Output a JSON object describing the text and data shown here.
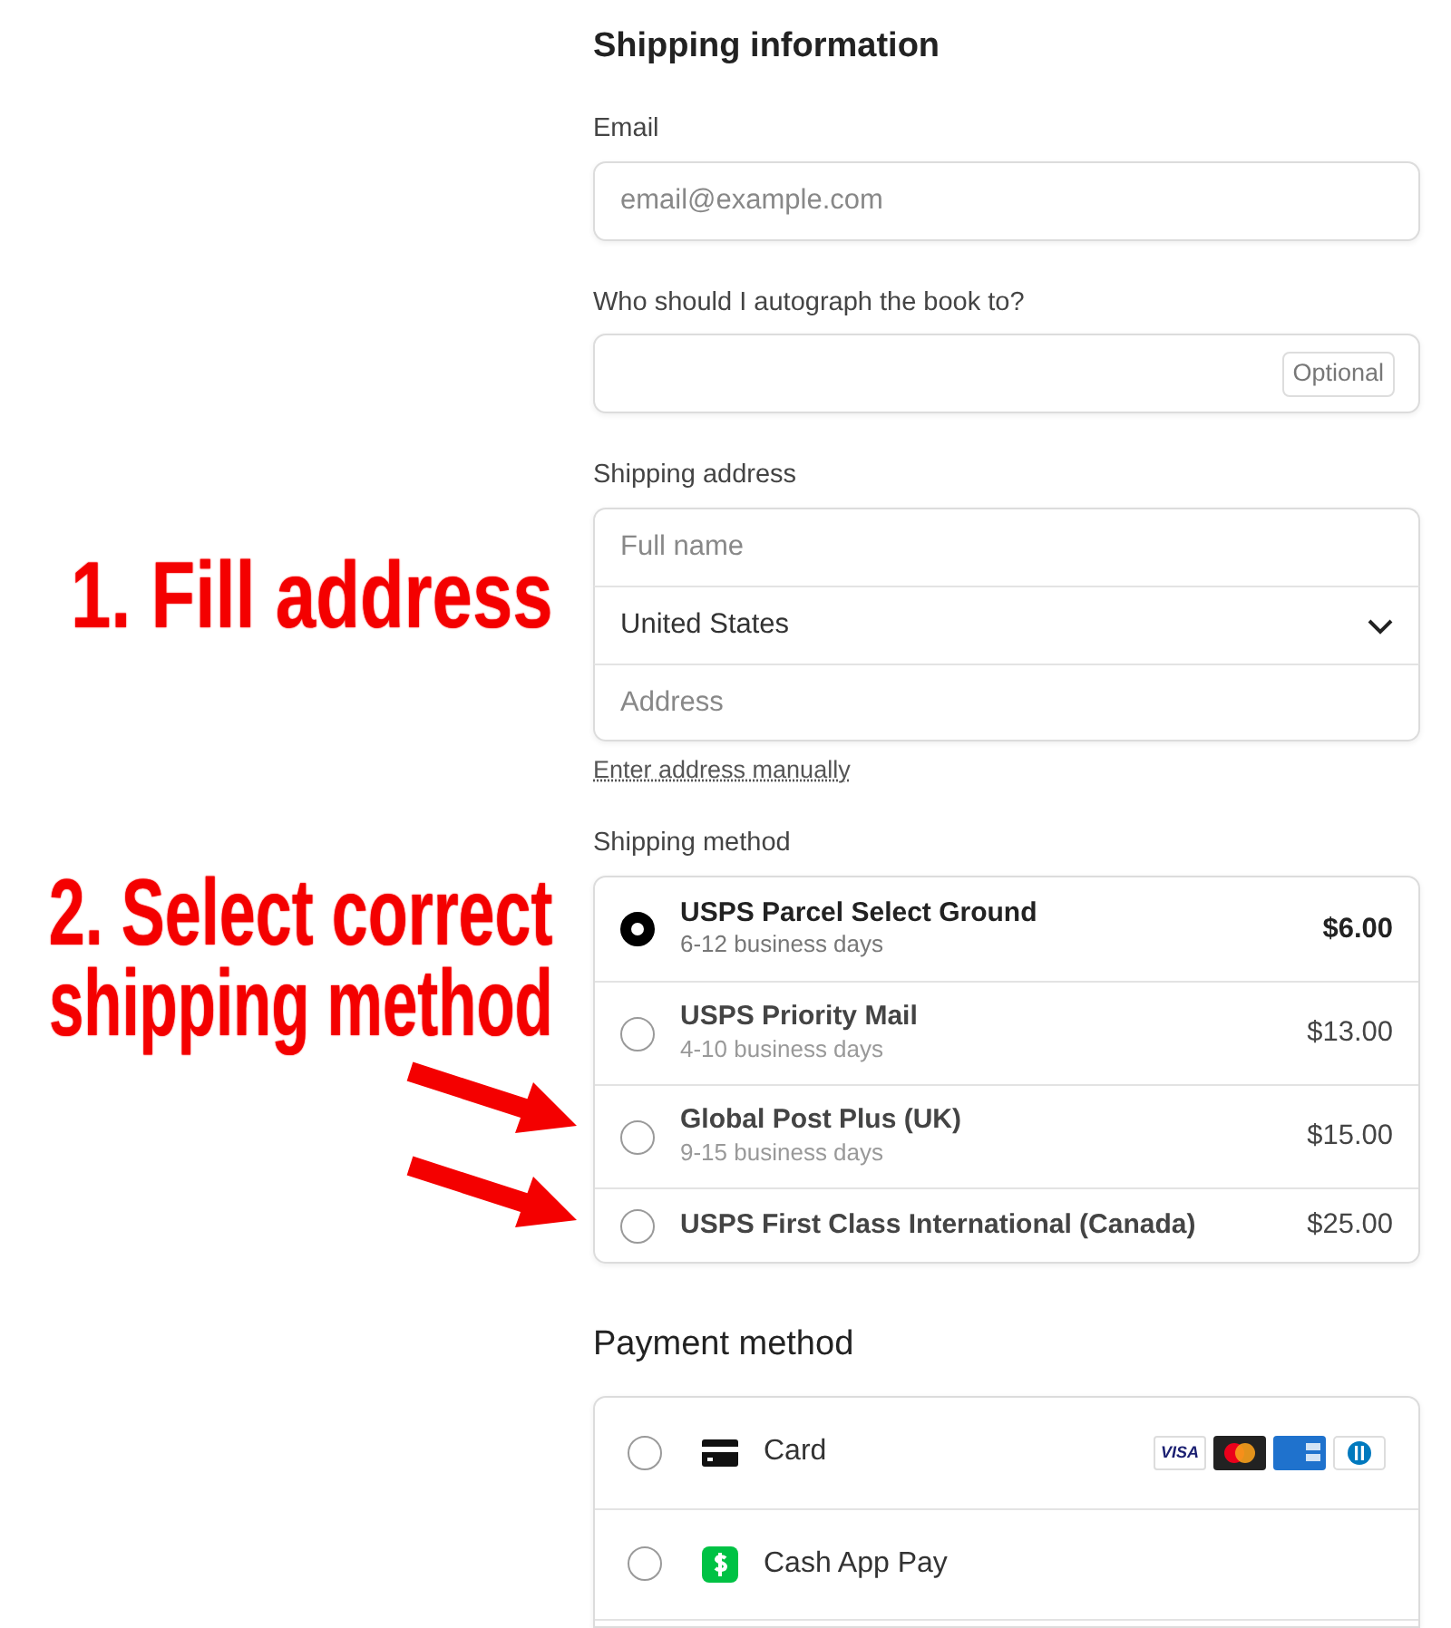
{
  "heading": "Shipping information",
  "email": {
    "label": "Email",
    "placeholder": "email@example.com"
  },
  "autograph": {
    "label": "Who should I autograph the book to?",
    "badge": "Optional"
  },
  "shipping_address": {
    "label": "Shipping address",
    "full_name": {
      "placeholder": "Full name"
    },
    "country": {
      "value": "United States"
    },
    "address": {
      "placeholder": "Address"
    },
    "manual_link": "Enter address manually"
  },
  "shipping_method": {
    "label": "Shipping method",
    "options": [
      {
        "name": "USPS Parcel Select Ground",
        "days": "6-12 business days",
        "price": "$6.00",
        "selected": true
      },
      {
        "name": "USPS Priority Mail",
        "days": "4-10 business days",
        "price": "$13.00",
        "selected": false
      },
      {
        "name": "Global Post Plus (UK)",
        "days": "9-15 business days",
        "price": "$15.00",
        "selected": false
      },
      {
        "name": "USPS First Class International (Canada)",
        "price": "$25.00",
        "selected": false
      }
    ]
  },
  "payment_method": {
    "heading": "Payment method",
    "options": [
      {
        "kind": "card",
        "label": "Card",
        "selected": false,
        "brands": [
          {
            "kind": "visa",
            "text": "VISA"
          },
          {
            "kind": "mastercard"
          },
          {
            "kind": "amex"
          },
          {
            "kind": "diners"
          }
        ]
      },
      {
        "kind": "cashapp",
        "label": "Cash App Pay",
        "selected": false
      }
    ]
  },
  "annotations": [
    {
      "lines": [
        "1. Fill address"
      ]
    },
    {
      "lines": [
        "2. Select correct",
        "shipping method"
      ]
    }
  ]
}
